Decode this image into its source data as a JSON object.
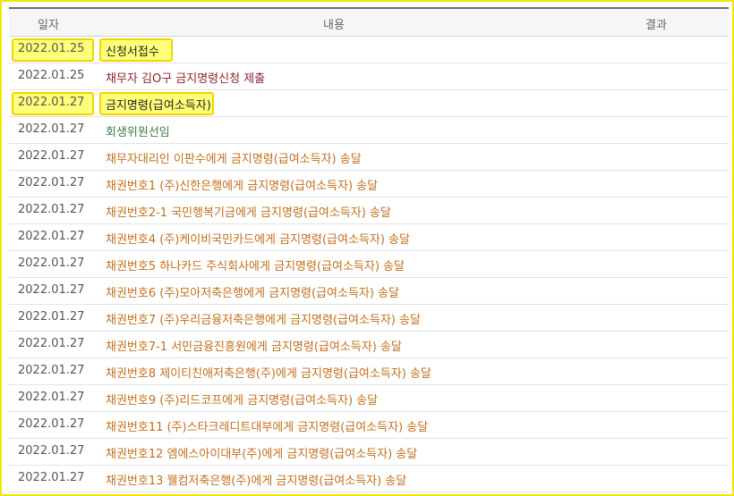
{
  "header": {
    "date": "일자",
    "content": "내용",
    "result": "결과"
  },
  "rows": [
    {
      "date": "2022.01.25",
      "content": "신청서접수",
      "color": "#222222"
    },
    {
      "date": "2022.01.25",
      "content": "채무자 김O구 금지명령신청 제출",
      "color": "#8a2430"
    },
    {
      "date": "2022.01.27",
      "content": "금지명령(급여소득자)",
      "color": "#222222"
    },
    {
      "date": "2022.01.27",
      "content": "회생위원선임",
      "color": "#3f7a4a"
    },
    {
      "date": "2022.01.27",
      "content": "채무자대리인 이판수에게 금지명령(급여소득자) 송달",
      "color": "#c0701c"
    },
    {
      "date": "2022.01.27",
      "content": "채권번호1 (주)신한은행에게 금지명령(급여소득자) 송달",
      "color": "#c0701c"
    },
    {
      "date": "2022.01.27",
      "content": "채권번호2-1 국민행복기금에게 금지명령(급여소득자) 송달",
      "color": "#c0701c"
    },
    {
      "date": "2022.01.27",
      "content": "채권번호4 (주)케이비국민카드에게 금지명령(급여소득자) 송달",
      "color": "#c0701c"
    },
    {
      "date": "2022.01.27",
      "content": "채권번호5 하나카드 주식회사에게 금지명령(급여소득자) 송달",
      "color": "#c0701c"
    },
    {
      "date": "2022.01.27",
      "content": "채권번호6 (주)모아저축은행에게 금지명령(급여소득자) 송달",
      "color": "#c0701c"
    },
    {
      "date": "2022.01.27",
      "content": "채권번호7 (주)우리금융저축은행에게 금지명령(급여소득자) 송달",
      "color": "#c0701c"
    },
    {
      "date": "2022.01.27",
      "content": "채권번호7-1 서민금융진흥원에게 금지명령(급여소득자) 송달",
      "color": "#c0701c"
    },
    {
      "date": "2022.01.27",
      "content": "채권번호8 제이티친애저축은행(주)에게 금지명령(급여소득자) 송달",
      "color": "#c0701c"
    },
    {
      "date": "2022.01.27",
      "content": "채권번호9 (주)리드코프에게 금지명령(급여소득자) 송달",
      "color": "#c0701c"
    },
    {
      "date": "2022.01.27",
      "content": "채권번호11 (주)스타크레디트대부에게 금지명령(급여소득자) 송달",
      "color": "#c0701c"
    },
    {
      "date": "2022.01.27",
      "content": "채권번호12 엠에스아이대부(주)에게 금지명령(급여소득자) 송달",
      "color": "#c0701c"
    },
    {
      "date": "2022.01.27",
      "content": "채권번호13 웰컴저축은행(주)에게 금지명령(급여소득자) 송달",
      "color": "#c0701c"
    }
  ]
}
